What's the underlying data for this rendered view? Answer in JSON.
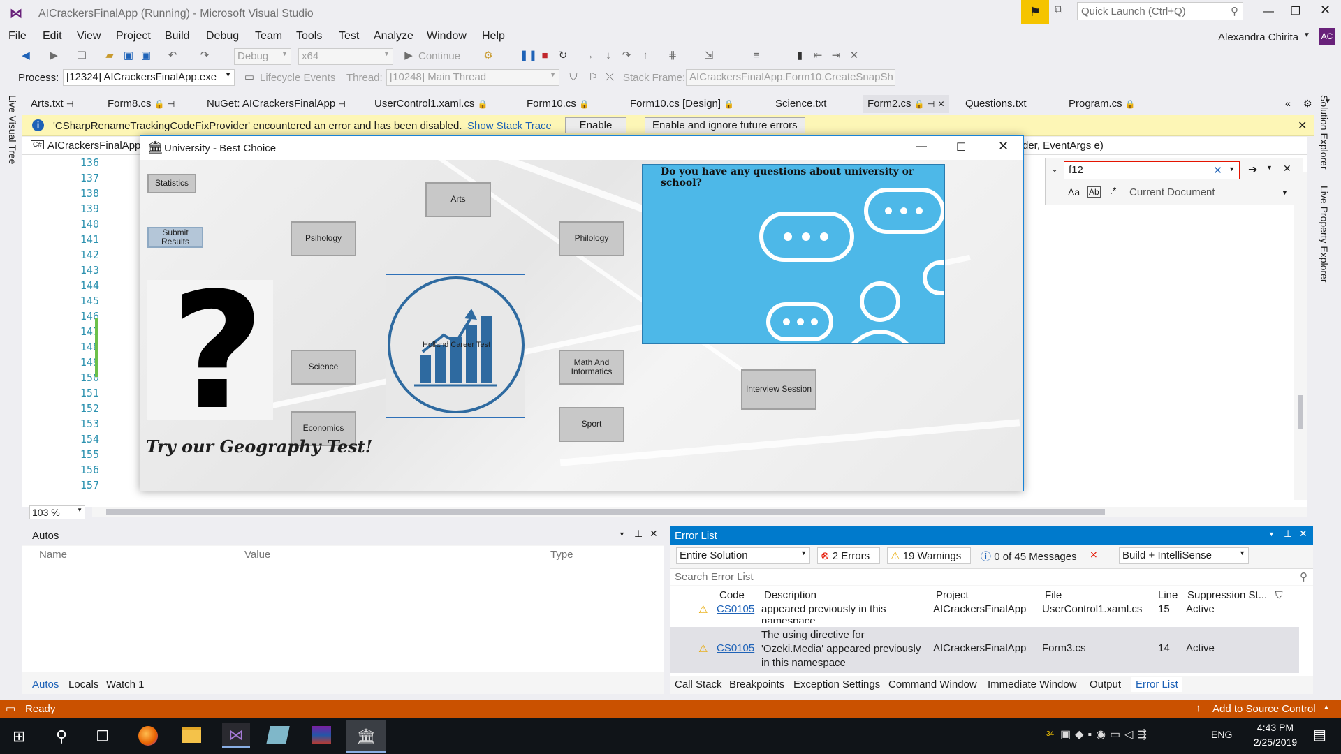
{
  "window": {
    "title": "AICrackersFinalApp (Running) - Microsoft Visual Studio",
    "quick_launch": "Quick Launch (Ctrl+Q)",
    "user": "Alexandra Chirita",
    "user_initials": "AC"
  },
  "menu": [
    "File",
    "Edit",
    "View",
    "Project",
    "Build",
    "Debug",
    "Team",
    "Tools",
    "Test",
    "Analyze",
    "Window",
    "Help"
  ],
  "toolbar": {
    "config": "Debug",
    "platform": "x64",
    "continue": "Continue"
  },
  "debug_location": {
    "process_label": "Process:",
    "process": "[12324] AICrackersFinalApp.exe",
    "lifecycle": "Lifecycle Events",
    "thread_label": "Thread:",
    "thread": "[10248] Main Thread",
    "frame_label": "Stack Frame:",
    "frame": "AICrackersFinalApp.Form10.CreateSnapSh"
  },
  "tabs": [
    "Arts.txt",
    "Form8.cs",
    "NuGet: AICrackersFinalApp",
    "UserControl1.xaml.cs",
    "Form10.cs",
    "Form10.cs [Design]",
    "Science.txt",
    "Form2.cs",
    "Questions.txt",
    "Program.cs"
  ],
  "info_bar": {
    "message": "'CSharpRenameTrackingCodeFixProvider' encountered an error and has been disabled.",
    "link": "Show Stack Trace",
    "enable": "Enable",
    "ignore": "Enable and ignore future errors"
  },
  "editor": {
    "project": "AICrackersFinalApp",
    "method_sig": "der, EventArgs e)",
    "find_text": "f12",
    "find_scope": "Current Document",
    "zoom": "103 %",
    "line_numbers": [
      "136",
      "137",
      "138",
      "139",
      "140",
      "141",
      "142",
      "143",
      "144",
      "145",
      "146",
      "147",
      "148",
      "149",
      "150",
      "151",
      "152",
      "153",
      "154",
      "155",
      "156",
      "157"
    ]
  },
  "form": {
    "title": "University - Best Choice",
    "buttons": {
      "statistics": "Statistics",
      "submit": "Submit Results",
      "arts": "Arts",
      "psihology": "Psihology",
      "philology": "Philology",
      "science": "Science",
      "math": "Math And Informatics",
      "economics": "Economics",
      "sport": "Sport",
      "interview": "Interview Session",
      "holland": "Holland Career Test"
    },
    "question_banner": "Do you have any questions about university or school?",
    "geo": "Try our Geography Test!",
    "big_question": "?"
  },
  "autos": {
    "title": "Autos",
    "cols": [
      "Name",
      "Value",
      "Type"
    ],
    "tabs": [
      "Autos",
      "Locals",
      "Watch 1"
    ]
  },
  "error_list": {
    "title": "Error List",
    "scope": "Entire Solution",
    "errors": "2 Errors",
    "warnings": "19 Warnings",
    "messages": "0 of 45 Messages",
    "build": "Build + IntelliSense",
    "search": "Search Error List",
    "cols": [
      "Code",
      "Description",
      "Project",
      "File",
      "Line",
      "Suppression St..."
    ],
    "rows": [
      {
        "code": "CS0105",
        "desc": "appeared previously in this namespace",
        "project": "AICrackersFinalApp",
        "file": "UserControl1.xaml.cs",
        "line": "15",
        "supp": "Active"
      },
      {
        "code": "CS0105",
        "desc": "The using directive for 'Ozeki.Media' appeared previously in this namespace",
        "project": "AICrackersFinalApp",
        "file": "Form3.cs",
        "line": "14",
        "supp": "Active"
      }
    ],
    "tabs": [
      "Call Stack",
      "Breakpoints",
      "Exception Settings",
      "Command Window",
      "Immediate Window",
      "Output",
      "Error List"
    ]
  },
  "status": {
    "ready": "Ready",
    "source": "Add to Source Control"
  },
  "sidebars": {
    "left": "Live Visual Tree",
    "right1": "Solution Explorer",
    "right2": "Live Property Explorer"
  },
  "taskbar": {
    "time": "4:43 PM",
    "date": "2/25/2019",
    "lang": "ENG",
    "badge": "34"
  }
}
